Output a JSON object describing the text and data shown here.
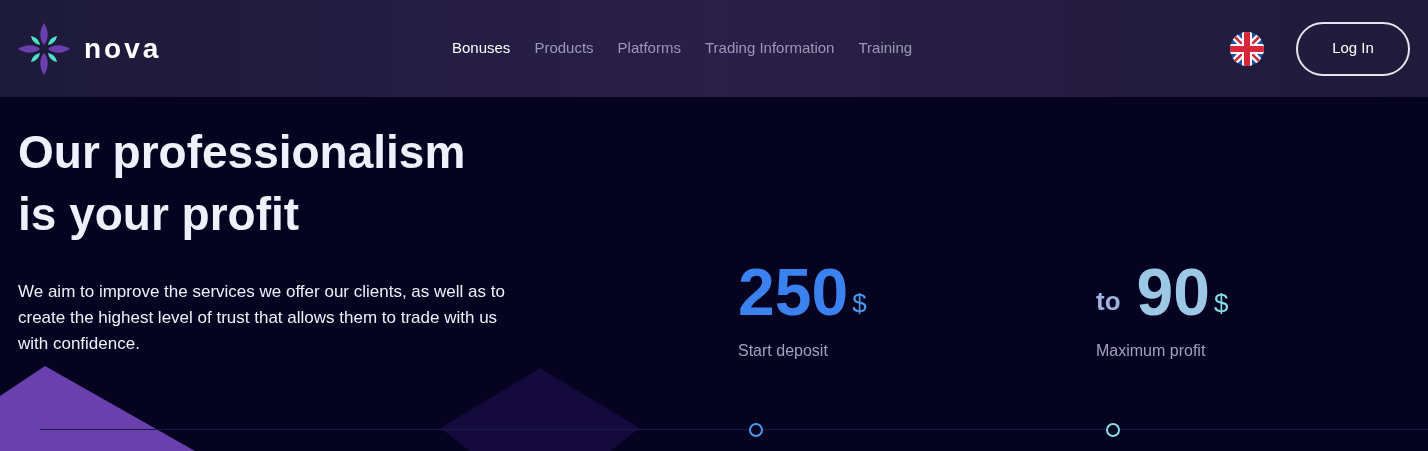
{
  "logo": {
    "text": "nova"
  },
  "nav": [
    {
      "label": "Bonuses",
      "selected": true
    },
    {
      "label": "Products",
      "selected": false
    },
    {
      "label": "Platforms",
      "selected": false
    },
    {
      "label": "Trading Information",
      "selected": false
    },
    {
      "label": "Training",
      "selected": false
    }
  ],
  "login_button": "Log In",
  "hero": {
    "title_lines": [
      "Our professionalism",
      "is your profit"
    ],
    "text": "We aim to improve the services we offer our clients, as well as to create the highest level of trust that allows them to trade with us with confidence."
  },
  "stats": [
    {
      "value": "250",
      "unit": "$",
      "label": "Start deposit"
    },
    {
      "prefix": "to",
      "value": "90",
      "unit": "$",
      "label": "Maximum profit"
    }
  ]
}
